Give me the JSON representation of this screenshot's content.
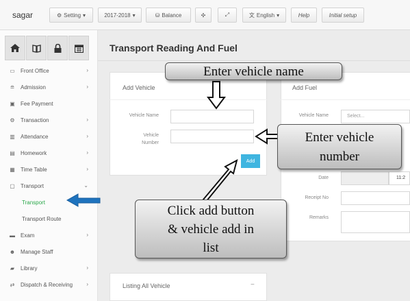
{
  "topbar": {
    "brand": "sagar",
    "setting": "Setting",
    "session": "2017-2018",
    "balance": "Balance",
    "language": "English",
    "help": "Help",
    "initial_setup": "Initial setup"
  },
  "sidebar": {
    "items": [
      {
        "label": "Front Office",
        "icon": "monitor-icon"
      },
      {
        "label": "Admission",
        "icon": "graduation-cap-icon"
      },
      {
        "label": "Fee Payment",
        "icon": "money-icon"
      },
      {
        "label": "Transaction",
        "icon": "gear-icon"
      },
      {
        "label": "Attendance",
        "icon": "bar-chart-icon"
      },
      {
        "label": "Homework",
        "icon": "book-icon"
      },
      {
        "label": "Time Table",
        "icon": "calendar-icon"
      },
      {
        "label": "Transport",
        "icon": "bus-icon"
      },
      {
        "label": "Transport"
      },
      {
        "label": "Transport Route"
      },
      {
        "label": "Exam",
        "icon": "document-icon"
      },
      {
        "label": "Manage Staff",
        "icon": "users-icon"
      },
      {
        "label": "Library",
        "icon": "library-icon"
      },
      {
        "label": "Dispatch & Receiving",
        "icon": "exchange-icon"
      }
    ]
  },
  "page": {
    "title": "Transport Reading And Fuel"
  },
  "add_vehicle": {
    "title": "Add Vehicle",
    "vehicle_name_label": "Vehicle Name",
    "vehicle_number_label_1": "Vehicle",
    "vehicle_number_label_2": "Number",
    "add_button": "Add"
  },
  "add_fuel": {
    "title": "Add Fuel",
    "vehicle_name_label": "Vehicle Name",
    "vehicle_placeholder": "Select...",
    "date_label": "Date",
    "time_value": "11:2",
    "receipt_label": "Receipt No",
    "remarks_label": "Remarks"
  },
  "listing": {
    "title": "Listing All Vehicle",
    "collapse": "−"
  },
  "callouts": {
    "vehicle_name": "Enter vehicle name",
    "vehicle_number_1": "Enter vehicle",
    "vehicle_number_2": "number",
    "add_1": "Click add  button",
    "add_2": "& vehicle add in",
    "add_3": "list"
  },
  "colors": {
    "accent": "#3fb5e0",
    "active_menu": "#2aa84a",
    "pointer_arrow": "#1e73be"
  }
}
